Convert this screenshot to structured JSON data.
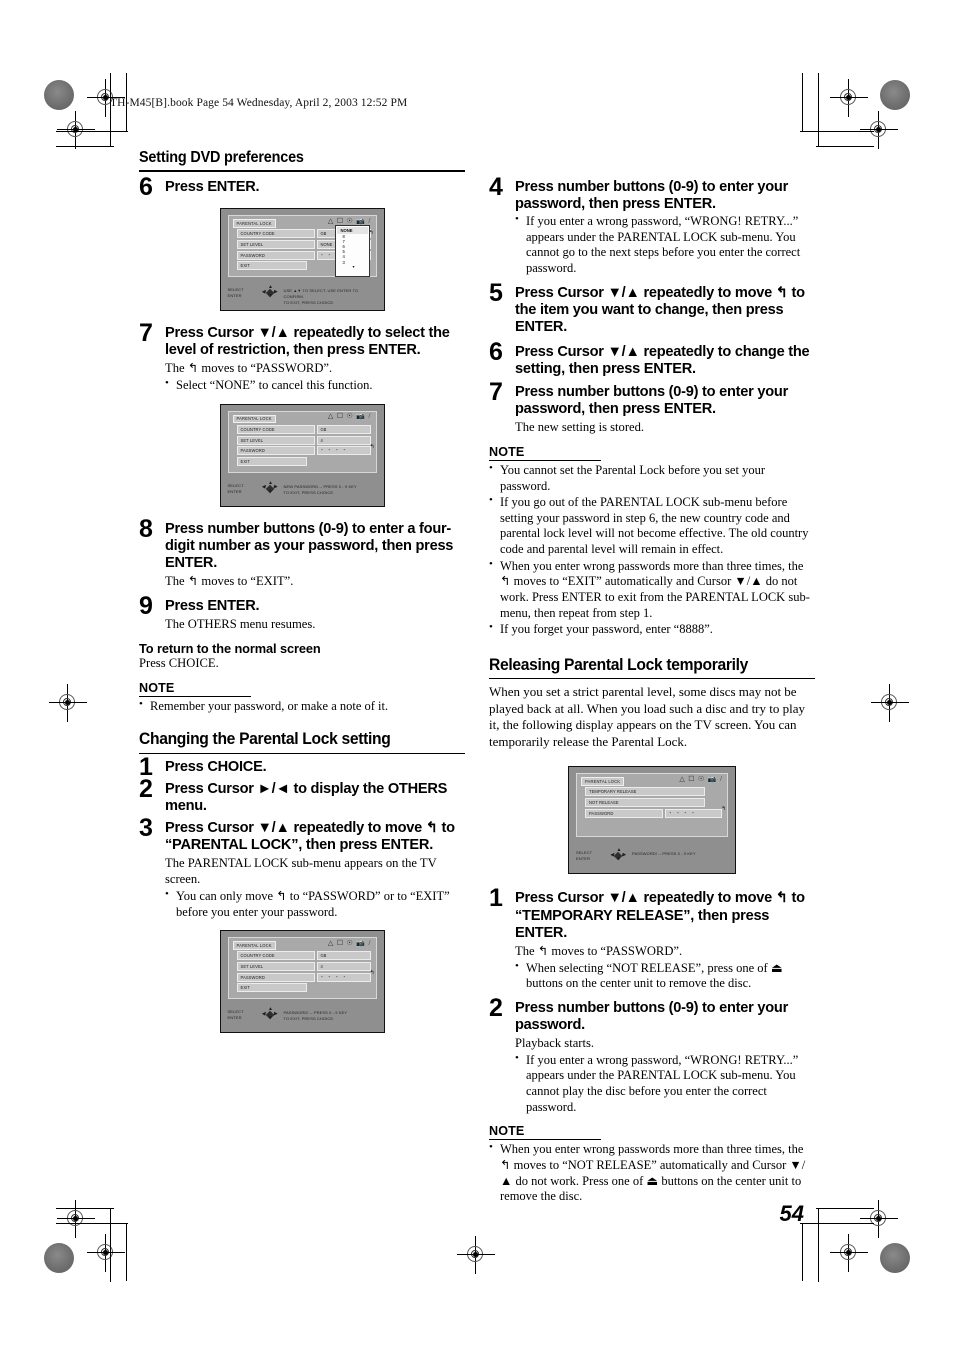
{
  "page": {
    "header_line": "TH-M45[B].book  Page 54  Wednesday, April 2, 2003  12:52 PM",
    "page_number": "54"
  },
  "left_column": {
    "section_title": "Setting DVD preferences",
    "steps": [
      {
        "num": "6",
        "text": "Press ENTER."
      },
      {
        "num": "7",
        "text": "Press Cursor ▼/▲ repeatedly to select the level of restriction, then press ENTER.",
        "body": "The ↰ moves to “PASSWORD”.",
        "bullets": [
          "Select “NONE” to cancel this function."
        ]
      },
      {
        "num": "8",
        "text": "Press number buttons (0-9) to enter a four-digit number as your password, then press ENTER.",
        "body": "The ↰ moves to “EXIT”."
      },
      {
        "num": "9",
        "text": "Press ENTER.",
        "body": "The OTHERS menu resumes."
      }
    ],
    "return_head": "To return to the normal screen",
    "return_body": "Press CHOICE.",
    "note_head": "NOTE",
    "note_bullets": [
      "Remember your password, or make a note of it."
    ],
    "subsection_title": "Changing the Parental Lock setting",
    "sub_steps": [
      {
        "num": "1",
        "text": "Press CHOICE."
      },
      {
        "num": "2",
        "text": "Press Cursor ►/◄ to display the OTHERS menu."
      },
      {
        "num": "3",
        "text": "Press Cursor ▼/▲ repeatedly to move ↰ to “PARENTAL LOCK”, then press ENTER.",
        "body": "The PARENTAL LOCK sub-menu appears on the TV screen.",
        "bullets": [
          "You can only move ↰ to “PASSWORD” or to “EXIT” before you enter your password."
        ]
      }
    ]
  },
  "right_column": {
    "steps": [
      {
        "num": "4",
        "text": "Press number buttons (0-9) to enter your password, then press ENTER.",
        "bullets": [
          "If you enter a wrong password, “WRONG! RETRY...” appears under the PARENTAL LOCK sub-menu. You cannot go to the next steps before you enter the correct password."
        ]
      },
      {
        "num": "5",
        "text": "Press Cursor ▼/▲ repeatedly to move ↰ to the item you want to change, then press ENTER."
      },
      {
        "num": "6",
        "text": "Press Cursor ▼/▲ repeatedly to change the setting, then press ENTER."
      },
      {
        "num": "7",
        "text": "Press number buttons (0-9) to enter your password, then press ENTER.",
        "body": "The new setting is stored."
      }
    ],
    "note_head": "NOTE",
    "note_bullets": [
      "You cannot set the Parental Lock before you set your password.",
      "If you go out of the PARENTAL LOCK sub-menu before setting your password in step 6, the new country code and parental lock level will not become effective. The old country code and parental level will remain in effect.",
      "When you enter wrong passwords more than three times, the ↰ moves to “EXIT” automatically and Cursor ▼/▲ do not work. Press ENTER to exit from the PARENTAL LOCK sub-menu, then repeat from step 1.",
      "If you forget your password, enter “8888”."
    ],
    "section2_title": "Releasing Parental Lock temporarily",
    "section2_para": "When you set a strict parental level, some discs may not be played back at all. When you load such a disc and try to play it, the following display appears on the TV screen. You can temporarily release the Parental Lock.",
    "steps2": [
      {
        "num": "1",
        "text": "Press Cursor ▼/▲ repeatedly to move ↰ to “TEMPORARY RELEASE”, then press ENTER.",
        "body": "The ↰ moves to “PASSWORD”.",
        "bullets": [
          "When selecting “NOT RELEASE”, press one of ⏏ buttons on the center unit to remove the disc."
        ]
      },
      {
        "num": "2",
        "text": "Press number buttons (0-9) to enter your password.",
        "body": "Playback starts.",
        "bullets": [
          "If you enter a wrong password, “WRONG! RETRY...” appears under the PARENTAL LOCK sub-menu. You cannot play the disc before you enter the correct password."
        ]
      }
    ],
    "note2_head": "NOTE",
    "note2_bullets": [
      "When you enter wrong passwords more than three times, the ↰ moves to “NOT RELEASE” automatically and Cursor ▼/▲ do not work. Press one of ⏏ buttons on the center unit to remove the disc."
    ]
  },
  "screenshots": {
    "shot1": {
      "title": "PARENTAL LOCK",
      "rows": [
        {
          "label": "COUNTRY CODE",
          "value": "GB"
        },
        {
          "label": "SET LEVEL",
          "value": "NONE"
        },
        {
          "label": "PASSWORD",
          "value": "- - - -"
        },
        {
          "label": "EXIT",
          "value": ""
        }
      ],
      "dropdown": {
        "selected": "NONE",
        "items": [
          "8",
          "7",
          "6",
          "5",
          "4",
          "3"
        ]
      },
      "foot_left": "SELECT",
      "foot_left2": "ENTER",
      "foot_right": "USE ▲▼ TO SELECT, USE ENTER TO CONFIRM.",
      "foot_right2": "TO EXIT, PRESS CHOICE."
    },
    "shot2": {
      "title": "PARENTAL LOCK",
      "rows": [
        {
          "label": "COUNTRY CODE",
          "value": "GB"
        },
        {
          "label": "SET LEVEL",
          "value": "4"
        },
        {
          "label": "PASSWORD",
          "value": "- - - -"
        },
        {
          "label": "EXIT",
          "value": ""
        }
      ],
      "foot_left": "SELECT",
      "foot_left2": "ENTER",
      "foot_right": "NEW PASSWORD  -- PRESS 0 - 9 KEY",
      "foot_right2": "TO EXIT, PRESS CHOICE."
    },
    "shot3": {
      "title": "PARENTAL LOCK",
      "rows": [
        {
          "label": "COUNTRY CODE",
          "value": "GB"
        },
        {
          "label": "SET LEVEL",
          "value": "4"
        },
        {
          "label": "PASSWORD",
          "value": "- - - -"
        },
        {
          "label": "EXIT",
          "value": ""
        }
      ],
      "foot_left": "SELECT",
      "foot_left2": "ENTER",
      "foot_right": "PASSWORD!  -- PRESS 0 - 9 KEY",
      "foot_right2": "TO EXIT, PRESS CHOICE."
    },
    "shot4": {
      "title": "PARENTAL LOCK",
      "rows": [
        {
          "label": "TEMPORARY RELEASE",
          "value": ""
        },
        {
          "label": "NOT RELEASE",
          "value": ""
        },
        {
          "label": "PASSWORD",
          "value": "- - - -"
        }
      ],
      "foot_left": "SELECT",
      "foot_left2": "ENTER",
      "foot_right": "PASSWORD!  -- PRESS 0 - 9 KEY",
      "foot_right2": ""
    },
    "icon_glyphs": [
      "subtitle-icon",
      "screen-icon",
      "audio-icon",
      "angle-icon",
      "slash-icon"
    ]
  }
}
